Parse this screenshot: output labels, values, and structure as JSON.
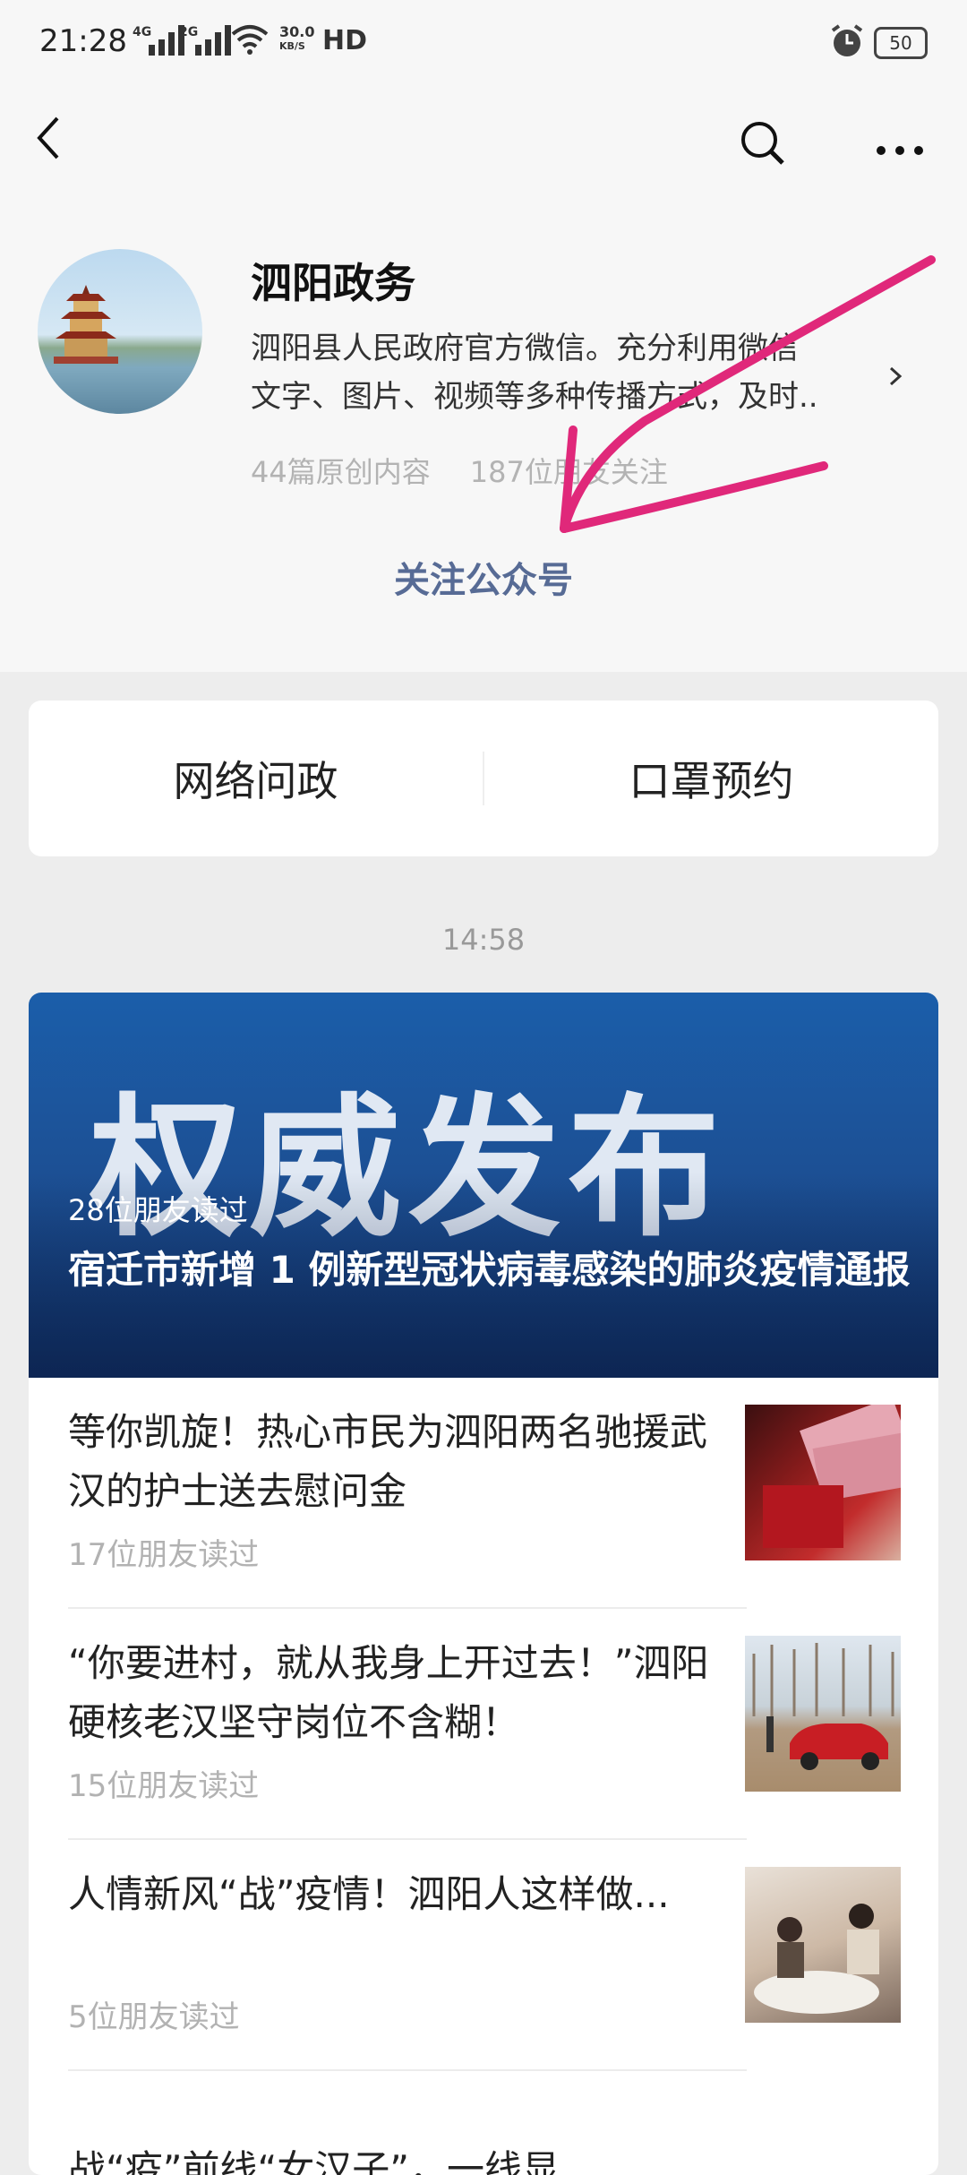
{
  "status_bar": {
    "time": "21:28",
    "sim1": "4G",
    "sim2": "2G",
    "net_rate": "30.0",
    "net_unit": "KB/S",
    "hd": "HD",
    "battery": "50"
  },
  "account": {
    "name": "泗阳政务",
    "desc_line1": "泗阳县人民政府官方微信。充分利用微信",
    "desc_line2": "文字、图片、视频等多种传播方式，及时..",
    "original_count": "44篇原创内容",
    "followers": "187位朋友关注",
    "follow_button": "关注公众号"
  },
  "menu": [
    {
      "label": "网络问政"
    },
    {
      "label": "口罩预约"
    }
  ],
  "timestamp": "14:58",
  "hero": {
    "image_text": "权威发布",
    "reads": "28位朋友读过",
    "title": "宿迁市新增 1 例新型冠状病毒感染的肺炎疫情通报"
  },
  "articles": [
    {
      "title": "等你凯旋！热心市民为泗阳两名驰援武汉的护士送去慰问金",
      "reads": "17位朋友读过"
    },
    {
      "title": "“你要进村，就从我身上开过去！”泗阳硬核老汉坚守岗位不含糊！",
      "reads": "15位朋友读过"
    },
    {
      "title": "人情新风“战”疫情！泗阳人这样做...",
      "reads": "5位朋友读过"
    }
  ],
  "partial_article": "战“疫”前线“女汉子”，一线显",
  "watermark": "泗阳政务",
  "colors": {
    "link": "#576b95",
    "annotation_arrow": "#e0287a",
    "hero_blue": "#1c4f93"
  }
}
